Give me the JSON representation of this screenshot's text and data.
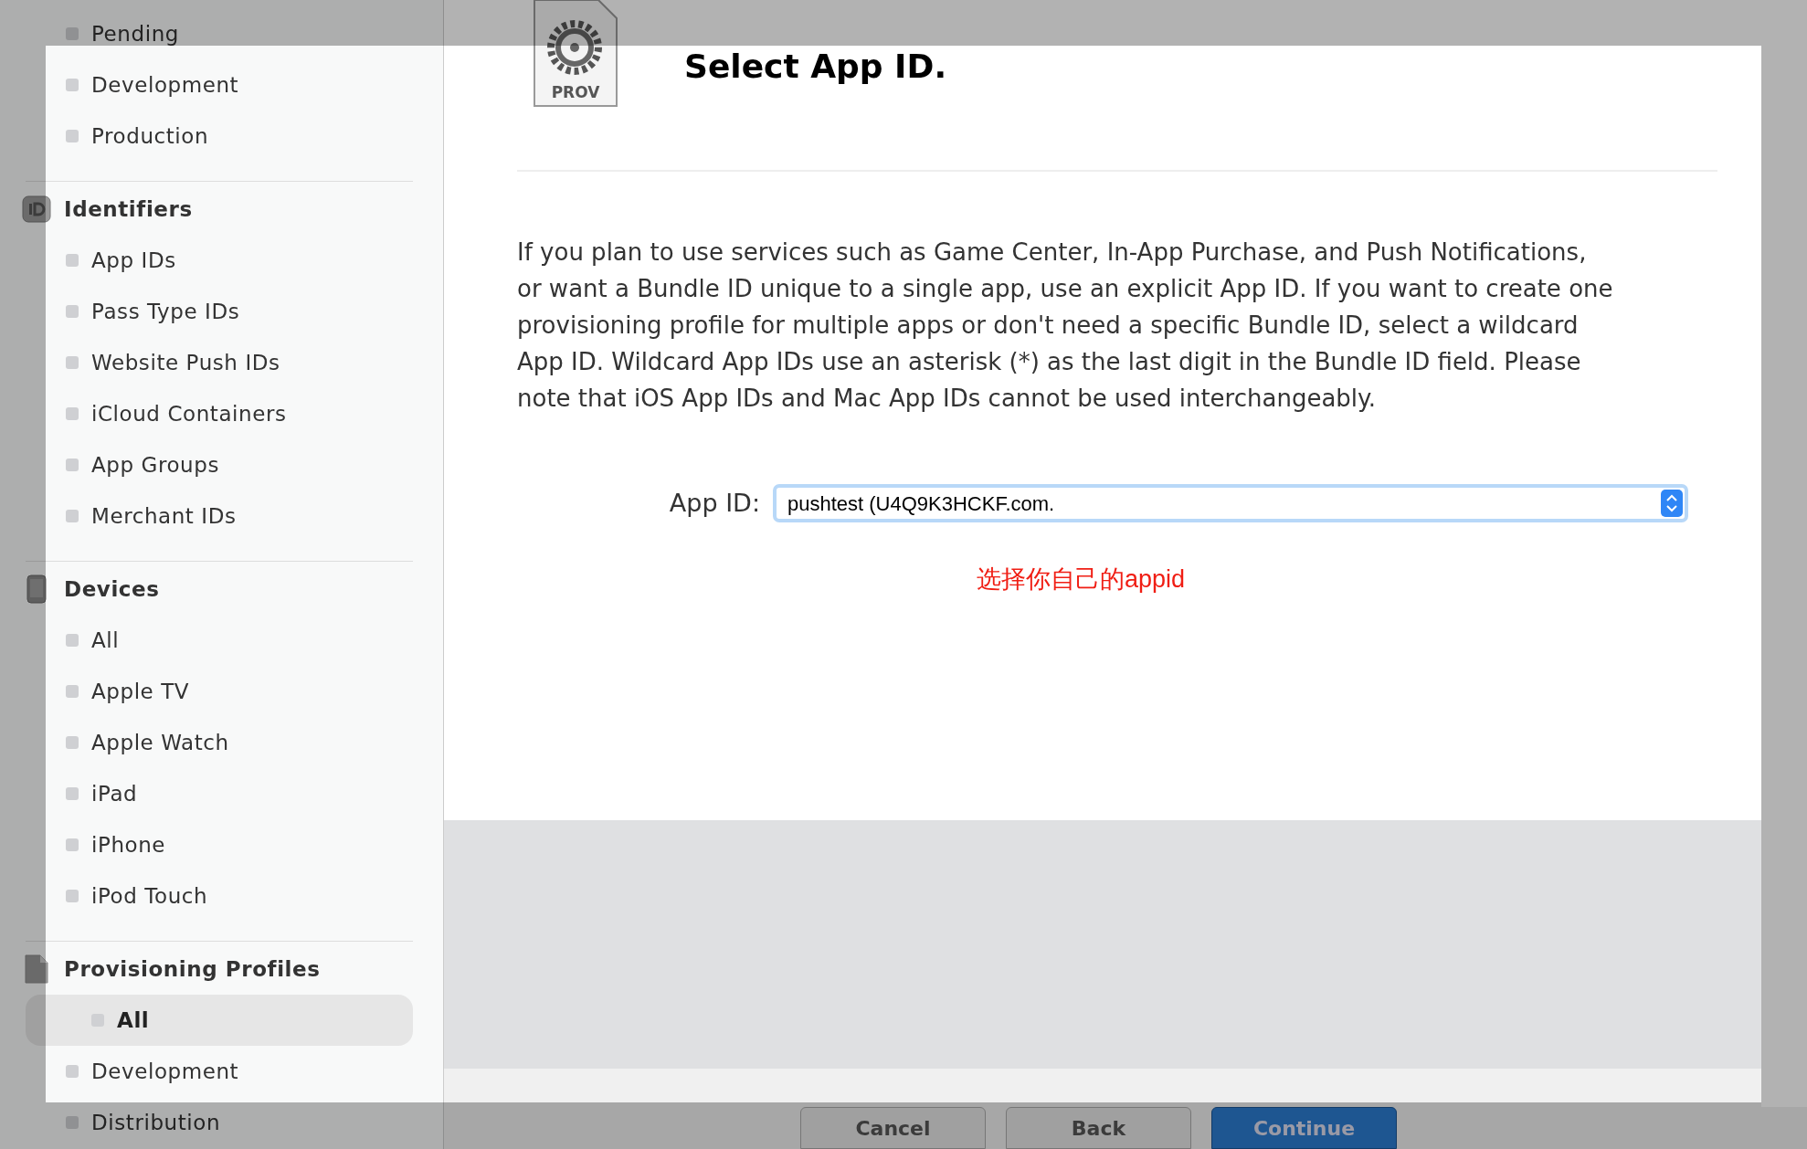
{
  "sidebar": {
    "top_items": [
      {
        "label": "Pending",
        "selected": false
      },
      {
        "label": "Development",
        "selected": false
      },
      {
        "label": "Production",
        "selected": false
      }
    ],
    "sections": [
      {
        "title": "Identifiers",
        "kind": "id",
        "items": [
          {
            "label": "App IDs",
            "selected": false
          },
          {
            "label": "Pass Type IDs",
            "selected": false
          },
          {
            "label": "Website Push IDs",
            "selected": false
          },
          {
            "label": "iCloud Containers",
            "selected": false
          },
          {
            "label": "App Groups",
            "selected": false
          },
          {
            "label": "Merchant IDs",
            "selected": false
          }
        ]
      },
      {
        "title": "Devices",
        "kind": "device",
        "items": [
          {
            "label": "All",
            "selected": false
          },
          {
            "label": "Apple TV",
            "selected": false
          },
          {
            "label": "Apple Watch",
            "selected": false
          },
          {
            "label": "iPad",
            "selected": false
          },
          {
            "label": "iPhone",
            "selected": false
          },
          {
            "label": "iPod Touch",
            "selected": false
          }
        ]
      },
      {
        "title": "Provisioning Profiles",
        "kind": "document",
        "items": [
          {
            "label": "All",
            "selected": true
          },
          {
            "label": "Development",
            "selected": false
          },
          {
            "label": "Distribution",
            "selected": false
          }
        ]
      }
    ]
  },
  "main": {
    "icon_label": "PROV",
    "title": "Select App ID.",
    "description": "If you plan to use services such as Game Center, In-App Purchase, and Push Notifications, or want a Bundle ID unique to a single app, use an explicit App ID. If you want to create one provisioning profile for multiple apps or don't need a specific Bundle ID, select a wildcard App ID. Wildcard App IDs use an asterisk (*) as the last digit in the Bundle ID field. Please note that iOS App IDs and Mac App IDs cannot be used interchangeably.",
    "app_id": {
      "label": "App ID:",
      "value": "pushtest (U4Q9K3HCKF.com."
    },
    "note": "选择你自己的appid",
    "buttons": [
      {
        "label": "Cancel",
        "kind": "secondary"
      },
      {
        "label": "Back",
        "kind": "secondary"
      },
      {
        "label": "Continue",
        "kind": "primary"
      }
    ]
  }
}
